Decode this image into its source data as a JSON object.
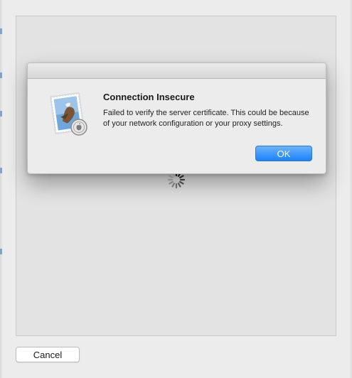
{
  "alert": {
    "title": "Connection Insecure",
    "message": "Failed to verify the server certificate. This could be because of your network configuration or your proxy settings.",
    "ok_label": "OK",
    "icon": "mail-app-icon"
  },
  "sheet": {
    "cancel_label": "Cancel",
    "loading_icon": "loading-spinner-icon"
  },
  "colors": {
    "accent": "#1a82fb",
    "background": "#ececec"
  }
}
